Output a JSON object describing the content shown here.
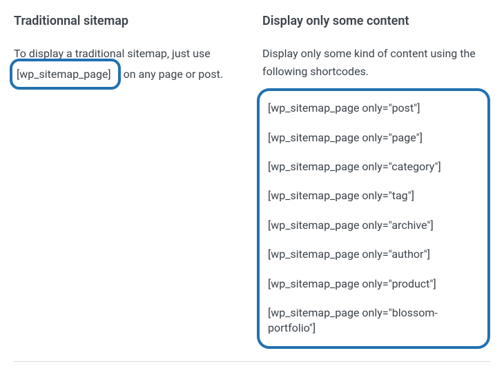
{
  "left": {
    "heading": "Traditionnal sitemap",
    "text_before": "To display a traditional sitemap, just use ",
    "shortcode": "[wp_sitemap_page]",
    "text_after": " on any page or post."
  },
  "right": {
    "heading": "Display only some content",
    "intro": "Display only some kind of content using the following shortcodes.",
    "shortcodes": [
      "[wp_sitemap_page only=\"post\"]",
      "[wp_sitemap_page only=\"page\"]",
      "[wp_sitemap_page only=\"category\"]",
      "[wp_sitemap_page only=\"tag\"]",
      "[wp_sitemap_page only=\"archive\"]",
      "[wp_sitemap_page only=\"author\"]",
      "[wp_sitemap_page only=\"product\"]",
      "[wp_sitemap_page only=\"blossom-portfolio\"]"
    ]
  }
}
